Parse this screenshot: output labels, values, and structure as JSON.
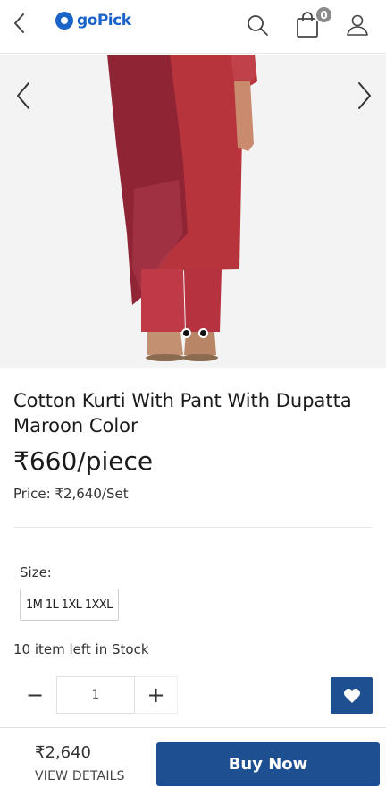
{
  "header": {
    "logo_text": "goPick",
    "cart_count": "0",
    "icons": [
      "back-arrow-icon",
      "search-icon",
      "shopping-bag-icon",
      "user-icon"
    ]
  },
  "gallery": {
    "icons": [
      "chevron-left-icon",
      "chevron-right-icon"
    ],
    "total_slides": 2,
    "active_slide": 1
  },
  "product": {
    "title": "Cotton Kurti With Pant With Dupatta Maroon Color",
    "price": "₹660/piece",
    "price_set": "Price: ₹2,640/Set",
    "size_label": "Size:",
    "size_option": "1M 1L 1XL 1XXL",
    "stock_text": "10 item left in Stock"
  },
  "quantity": {
    "minus": "−",
    "value": "1",
    "plus": "+"
  },
  "footer": {
    "total": "₹2,640",
    "view_details": "VIEW DETAILS",
    "buy_label": "Buy Now"
  },
  "colors": {
    "brand": "#1a63c9",
    "primary_button": "#1d4f91",
    "badge": "#8a8a8a"
  }
}
